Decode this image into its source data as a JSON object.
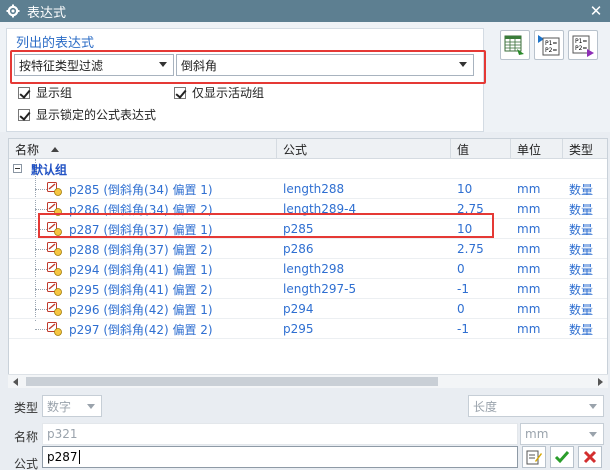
{
  "window": {
    "title": "表达式"
  },
  "list": {
    "section_title": "列出的表达式",
    "filter_type": "按特征类型过滤",
    "filter_value": "倒斜角",
    "show_groups": "显示组",
    "show_active_only": "仅显示活动组",
    "show_locked": "显示锁定的公式表达式"
  },
  "table": {
    "headers": {
      "name": "名称",
      "formula": "公式",
      "value": "值",
      "unit": "单位",
      "type": "类型"
    },
    "group": "默认组",
    "rows": [
      {
        "name": "p285  (倒斜角(34) 偏置 1)",
        "formula": "length288",
        "value": "10",
        "unit": "mm",
        "type": "数量"
      },
      {
        "name": "p286  (倒斜角(34) 偏置 2)",
        "formula": "length289-4",
        "value": "2.75",
        "unit": "mm",
        "type": "数量"
      },
      {
        "name": "p287  (倒斜角(37) 偏置 1)",
        "formula": "p285",
        "value": "10",
        "unit": "mm",
        "type": "数量"
      },
      {
        "name": "p288  (倒斜角(37) 偏置 2)",
        "formula": "p286",
        "value": "2.75",
        "unit": "mm",
        "type": "数量"
      },
      {
        "name": "p294  (倒斜角(41) 偏置 1)",
        "formula": "length298",
        "value": "0",
        "unit": "mm",
        "type": "数量"
      },
      {
        "name": "p295  (倒斜角(41) 偏置 2)",
        "formula": "length297-5",
        "value": "-1",
        "unit": "mm",
        "type": "数量"
      },
      {
        "name": "p296  (倒斜角(42) 偏置 1)",
        "formula": "p294",
        "value": "0",
        "unit": "mm",
        "type": "数量"
      },
      {
        "name": "p297  (倒斜角(42) 偏置 2)",
        "formula": "p295",
        "value": "-1",
        "unit": "mm",
        "type": "数量"
      }
    ]
  },
  "edit": {
    "type_label": "类型",
    "type_value": "数字",
    "dimension_value": "长度",
    "name_label": "名称",
    "name_value": "p321",
    "unit_value": "mm",
    "formula_label": "公式",
    "formula_value": "p287"
  },
  "colors": {
    "accent": "#2b6cc6",
    "highlight": "#e53935",
    "titlebar": "#5d7f91"
  }
}
